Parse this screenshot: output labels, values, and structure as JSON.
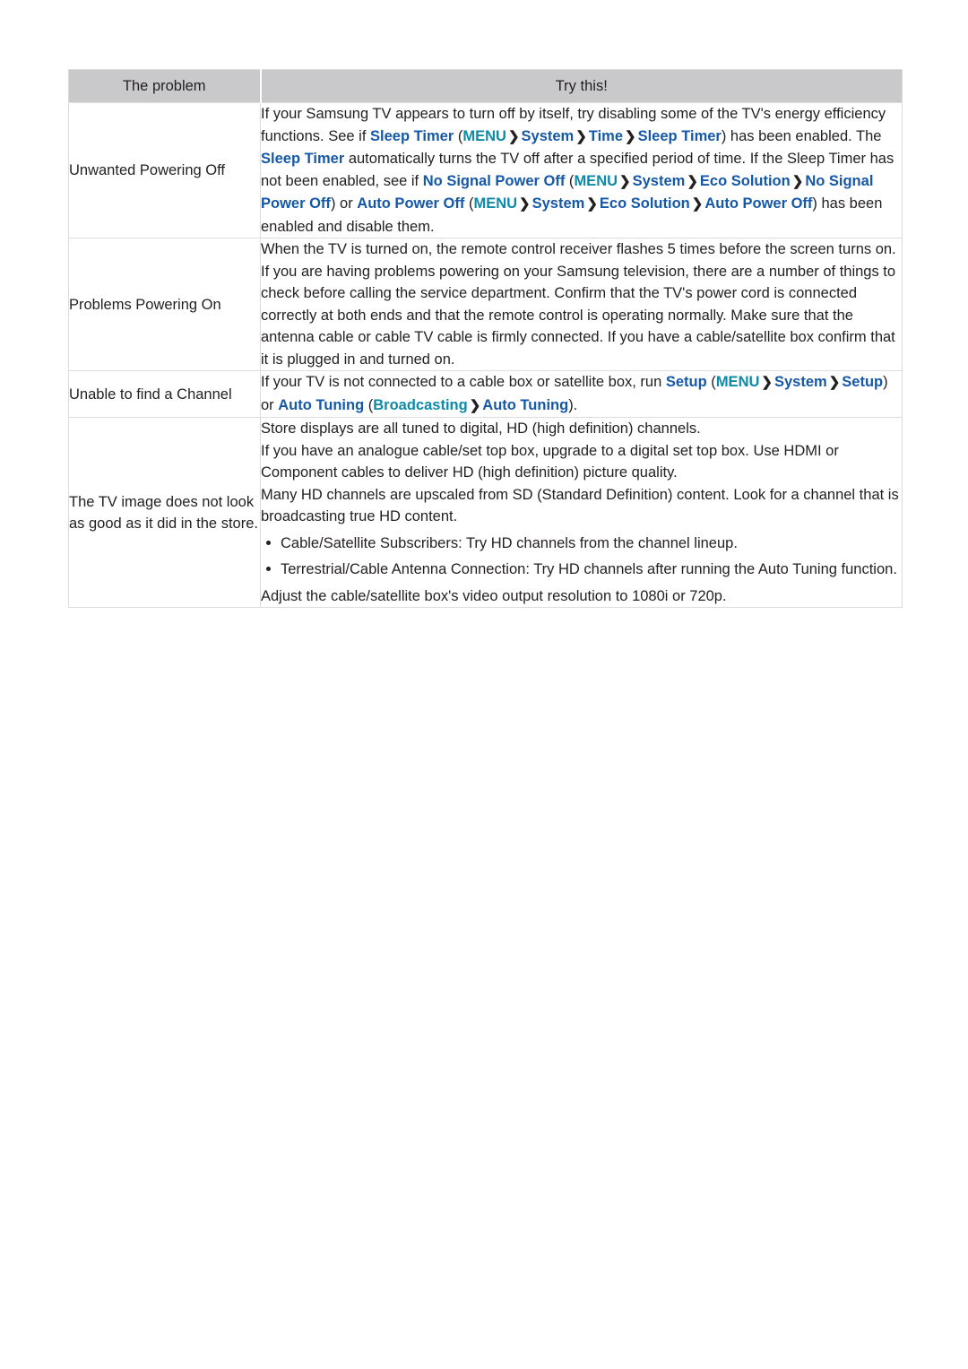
{
  "document": {
    "type": "troubleshooting-table",
    "colors": {
      "header_background": "#c9c9cc",
      "border": "#dcdcdc",
      "text": "#231f20",
      "menu_item_blue": "#1558a8",
      "menu_key_teal": "#0d8aa8"
    }
  },
  "table": {
    "headers": {
      "problem": "The problem",
      "solution": "Try this!"
    },
    "rows": [
      {
        "problem": "Unwanted Powering Off",
        "solution_text": "If your Samsung TV appears to turn off by itself, try disabling some of the TV's energy efficiency functions. See if Sleep Timer (MENU > System > Time > Sleep Timer) has been enabled. The Sleep Timer automatically turns the TV off after a specified period of time. If the Sleep Timer has not been enabled, see if No Signal Power Off (MENU > System > Eco Solution > No Signal Power Off) or Auto Power Off (MENU > System > Eco Solution > Auto Power Off) has been enabled and disable them.",
        "segments": [
          {
            "t": "If your Samsung TV appears to turn off by itself, try disabling some of the TV's energy efficiency functions. See if ",
            "s": "plain"
          },
          {
            "t": "Sleep Timer",
            "s": "blue"
          },
          {
            "t": " (",
            "s": "plain"
          },
          {
            "t": "MENU",
            "s": "teal"
          },
          {
            "t": "❯",
            "s": "chev"
          },
          {
            "t": "System",
            "s": "blue"
          },
          {
            "t": "❯",
            "s": "chev"
          },
          {
            "t": "Time",
            "s": "blue"
          },
          {
            "t": "❯",
            "s": "chev"
          },
          {
            "t": "Sleep Timer",
            "s": "blue"
          },
          {
            "t": ") has been enabled. The ",
            "s": "plain"
          },
          {
            "t": "Sleep Timer",
            "s": "blue"
          },
          {
            "t": " automatically turns the TV off after a specified period of time. If the Sleep Timer has not been enabled, see if ",
            "s": "plain"
          },
          {
            "t": "No Signal Power Off",
            "s": "blue"
          },
          {
            "t": " (",
            "s": "plain"
          },
          {
            "t": "MENU",
            "s": "teal"
          },
          {
            "t": "❯",
            "s": "chev"
          },
          {
            "t": "System",
            "s": "blue"
          },
          {
            "t": "❯",
            "s": "chev"
          },
          {
            "t": "Eco Solution",
            "s": "blue"
          },
          {
            "t": "❯",
            "s": "chev"
          },
          {
            "t": "No Signal Power Off",
            "s": "blue"
          },
          {
            "t": ") or ",
            "s": "plain"
          },
          {
            "t": "Auto Power Off",
            "s": "blue"
          },
          {
            "t": " (",
            "s": "plain"
          },
          {
            "t": "MENU",
            "s": "teal"
          },
          {
            "t": "❯",
            "s": "chev"
          },
          {
            "t": "System",
            "s": "blue"
          },
          {
            "t": "❯",
            "s": "chev"
          },
          {
            "t": "Eco Solution",
            "s": "blue"
          },
          {
            "t": "❯",
            "s": "chev"
          },
          {
            "t": "Auto Power Off",
            "s": "blue"
          },
          {
            "t": ") has been enabled and disable them.",
            "s": "plain"
          }
        ]
      },
      {
        "problem": "Problems Powering On",
        "solution_text": "When the TV is turned on, the remote control receiver flashes 5 times before the screen turns on. If you are having problems powering on your Samsung television, there are a number of things to check before calling the service department. Confirm that the TV's power cord is connected correctly at both ends and that the remote control is operating normally. Make sure that the antenna cable or cable TV cable is firmly connected. If you have a cable/satellite box confirm that it is plugged in and turned on.",
        "paragraphs": [
          "When the TV is turned on, the remote control receiver flashes 5 times before the screen turns on.",
          "If you are having problems powering on your Samsung television, there are a number of things to check before calling the service department. Confirm that the TV's power cord is connected correctly at both ends and that the remote control is operating normally. Make sure that the antenna cable or cable TV cable is firmly connected. If you have a cable/satellite box confirm that it is plugged in and turned on."
        ]
      },
      {
        "problem": "Unable to find a Channel",
        "solution_text": "If your TV is not connected to a cable box or satellite box, run Setup (MENU > System > Setup) or Auto Tuning (Broadcasting > Auto Tuning).",
        "segments": [
          {
            "t": "If your TV is not connected to a cable box or satellite box, run ",
            "s": "plain"
          },
          {
            "t": "Setup",
            "s": "blue"
          },
          {
            "t": " (",
            "s": "plain"
          },
          {
            "t": "MENU",
            "s": "teal"
          },
          {
            "t": "❯",
            "s": "chev"
          },
          {
            "t": "System",
            "s": "blue"
          },
          {
            "t": "❯",
            "s": "chev"
          },
          {
            "t": "Setup",
            "s": "blue"
          },
          {
            "t": ") or ",
            "s": "plain"
          },
          {
            "t": "Auto Tuning",
            "s": "blue"
          },
          {
            "t": " (",
            "s": "plain"
          },
          {
            "t": "Broadcasting",
            "s": "teal"
          },
          {
            "t": "❯",
            "s": "chev"
          },
          {
            "t": "Auto Tuning",
            "s": "blue"
          },
          {
            "t": ").",
            "s": "plain"
          }
        ]
      },
      {
        "problem": "The TV image does not look as good as it did in the store.",
        "solution_text": "Store displays are all tuned to digital, HD (high definition) channels. If you have an analogue cable/set top box, upgrade to a digital set top box. Use HDMI or Component cables to deliver HD (high definition) picture quality. Many HD channels are upscaled from SD (Standard Definition) content. Look for a channel that is broadcasting true HD content.",
        "paragraphs": [
          "Store displays are all tuned to digital, HD (high definition) channels.",
          "If you have an analogue cable/set top box, upgrade to a digital set top box. Use HDMI or Component cables to deliver HD (high definition) picture quality.",
          "Many HD channels are upscaled from SD (Standard Definition) content. Look for a channel that is broadcasting true HD content."
        ],
        "bullets": [
          "Cable/Satellite Subscribers: Try HD channels from the channel lineup.",
          "Terrestrial/Cable Antenna Connection: Try HD channels after running the Auto Tuning function."
        ],
        "closing": "Adjust the cable/satellite box's video output resolution to 1080i or 720p."
      }
    ]
  }
}
